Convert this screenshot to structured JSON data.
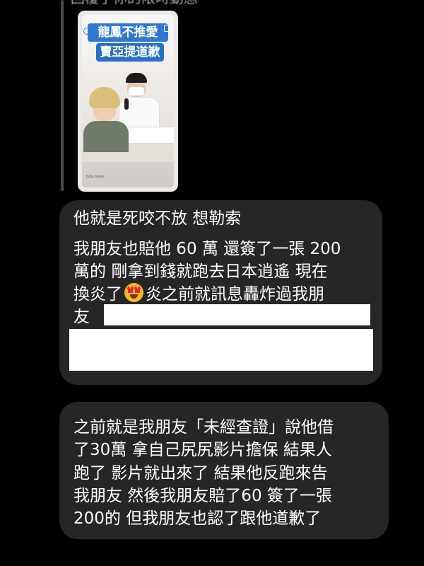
{
  "header": {
    "cut_text": "回覆了你的限時動態"
  },
  "story": {
    "headline_line1": "龍鳳不推愛",
    "headline_line2": "賣亞提道歉",
    "handle": "tvbs.news"
  },
  "messages": [
    {
      "lines": [
        "他就是死咬不放 想勒索",
        "我朋友也賠他 60 萬 還簽了一張 200",
        "萬的 剛拿到錢就跑去日本逍遙 現在",
        "換炎了",
        "炎之前就訊息轟炸過我朋",
        "友"
      ],
      "emoji": "heart-eyes-emoji"
    },
    {
      "lines": [
        "之前就是我朋友「未經查證」說他借",
        "了30萬 拿自己尻尻影片擔保 結果人",
        "跑了 影片就出來了 結果他反跑來告",
        "我朋友 然後我朋友賠了60 簽了一張",
        "200的 但我朋友也認了跟他道歉了"
      ]
    }
  ],
  "colors": {
    "background": "#000000",
    "bubble": "#262626",
    "text": "#ffffff",
    "redaction": "#ffffff"
  }
}
